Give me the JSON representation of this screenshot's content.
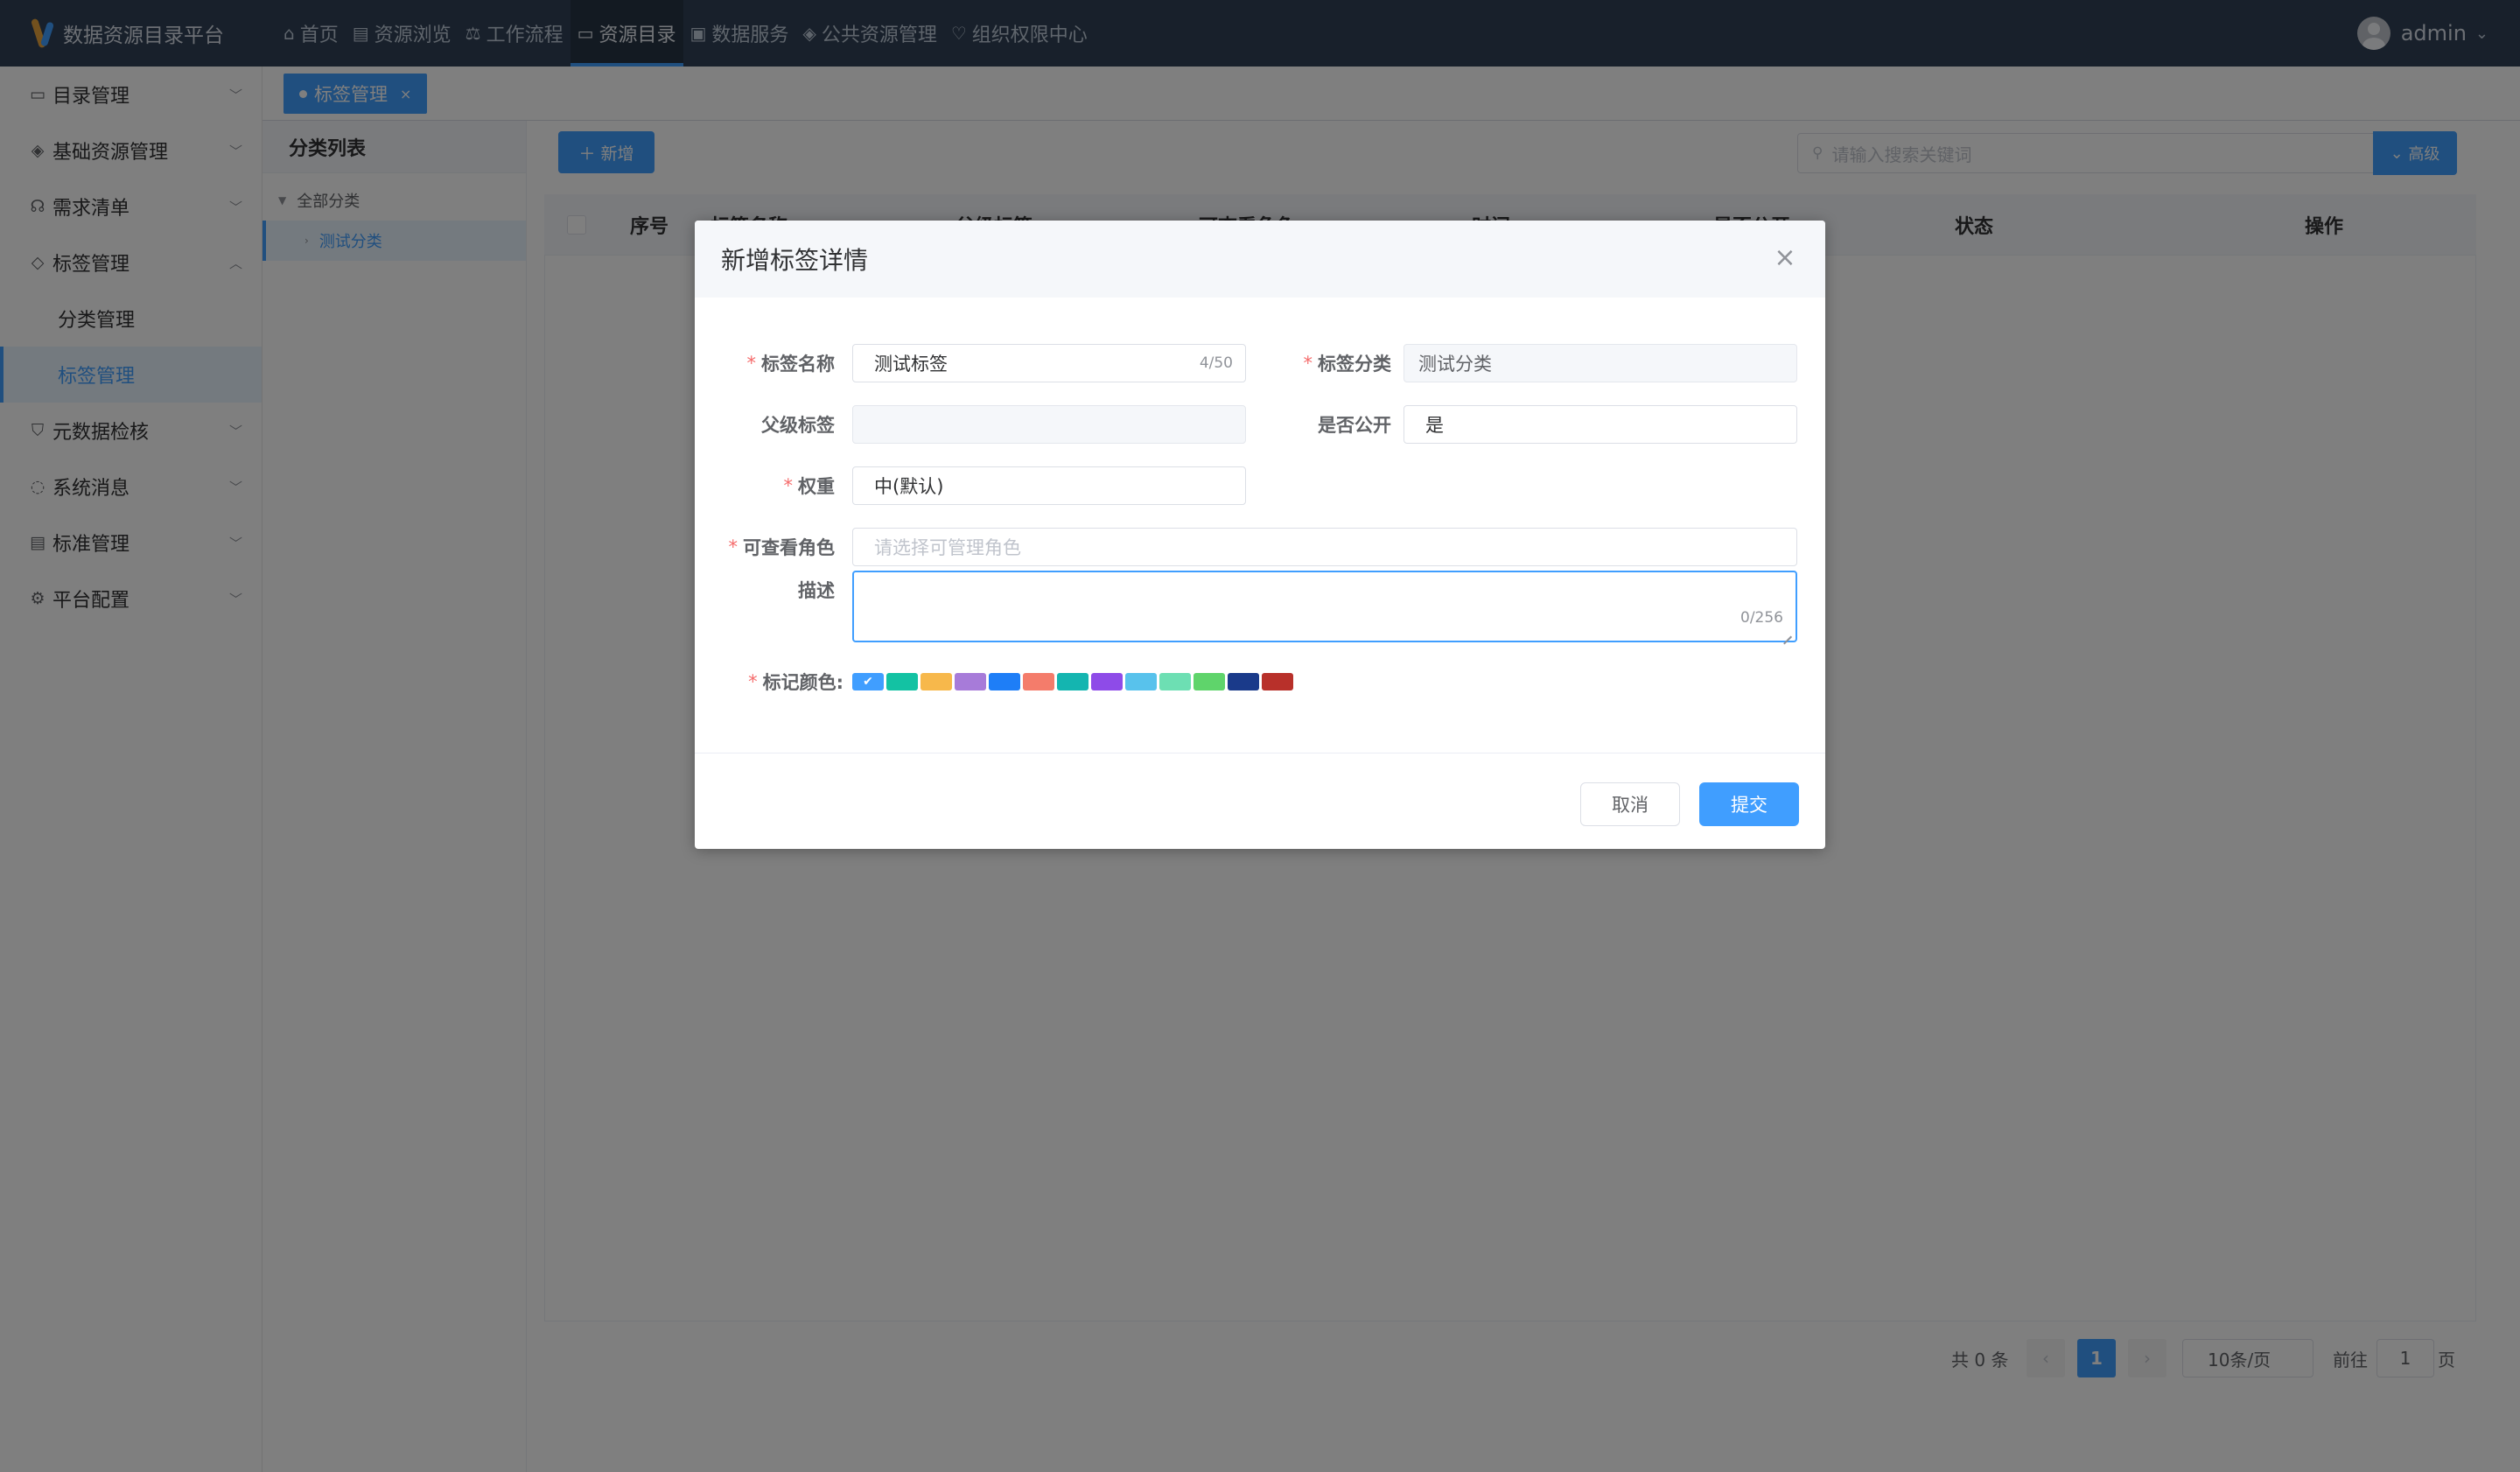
{
  "app": {
    "title": "数据资源目录平台"
  },
  "topnav": [
    {
      "label": "首页",
      "icon": "home-icon",
      "glyph": "⌂"
    },
    {
      "label": "资源浏览",
      "icon": "book-icon",
      "glyph": "▤"
    },
    {
      "label": "工作流程",
      "icon": "flow-icon",
      "glyph": "⚖"
    },
    {
      "label": "资源目录",
      "icon": "folder-icon",
      "glyph": "▭",
      "active": true
    },
    {
      "label": "数据服务",
      "icon": "box-icon",
      "glyph": "▣"
    },
    {
      "label": "公共资源管理",
      "icon": "gamepad-icon",
      "glyph": "◈"
    },
    {
      "label": "组织权限中心",
      "icon": "heart-icon",
      "glyph": "♡"
    }
  ],
  "user": {
    "name": "admin"
  },
  "sidebar": {
    "items": [
      {
        "label": "目录管理",
        "icon": "folder-icon",
        "glyph": "▭",
        "expanded": false
      },
      {
        "label": "基础资源管理",
        "icon": "layers-icon",
        "glyph": "◈",
        "expanded": false
      },
      {
        "label": "需求清单",
        "icon": "headset-icon",
        "glyph": "☊",
        "expanded": false
      },
      {
        "label": "标签管理",
        "icon": "tag-icon",
        "glyph": "◇",
        "expanded": true,
        "children": [
          {
            "label": "分类管理"
          },
          {
            "label": "标签管理",
            "active": true
          }
        ]
      },
      {
        "label": "元数据检核",
        "icon": "shield-icon",
        "glyph": "⛉",
        "expanded": false
      },
      {
        "label": "系统消息",
        "icon": "chat-icon",
        "glyph": "◌",
        "expanded": false
      },
      {
        "label": "标准管理",
        "icon": "clipboard-icon",
        "glyph": "▤",
        "expanded": false
      },
      {
        "label": "平台配置",
        "icon": "gear-icon",
        "glyph": "⚙",
        "expanded": false
      }
    ]
  },
  "tabs": [
    {
      "label": "标签管理",
      "active": true
    }
  ],
  "category_panel": {
    "title": "分类列表",
    "root": "全部分类",
    "children": [
      "测试分类"
    ]
  },
  "toolbar": {
    "add_label": "新增",
    "search_placeholder": "请输入搜索关键词",
    "advanced_label": "高级"
  },
  "table": {
    "columns": [
      "序号",
      "标签名称",
      "父级标签",
      "可查看角色",
      "时间",
      "是否公开",
      "状态",
      "操作"
    ],
    "rows": []
  },
  "pagination": {
    "total_text": "共 0 条",
    "current_page": "1",
    "page_size": "10条/页",
    "goto_label": "前往",
    "goto_value": "1",
    "page_unit": "页"
  },
  "dialog": {
    "title": "新增标签详情",
    "fields": {
      "name": {
        "label": "标签名称",
        "value": "测试标签",
        "counter": "4/50",
        "required": true
      },
      "category": {
        "label": "标签分类",
        "value": "测试分类",
        "required": true
      },
      "parent": {
        "label": "父级标签",
        "value": ""
      },
      "public": {
        "label": "是否公开",
        "value": "是"
      },
      "weight": {
        "label": "权重",
        "value": "中(默认)",
        "required": true
      },
      "roles": {
        "label": "可查看角色",
        "placeholder": "请选择可管理角色",
        "required": true
      },
      "description": {
        "label": "描述",
        "value": "",
        "counter": "0/256"
      },
      "color": {
        "label": "标记颜色:",
        "required": true
      }
    },
    "colors": [
      {
        "hex": "#409eff",
        "selected": true
      },
      {
        "hex": "#13c2a3",
        "selected": false
      },
      {
        "hex": "#f7b84b",
        "selected": false
      },
      {
        "hex": "#a77bd9",
        "selected": false
      },
      {
        "hex": "#1e7ef7",
        "selected": false
      },
      {
        "hex": "#f47c6b",
        "selected": false
      },
      {
        "hex": "#14b5b0",
        "selected": false
      },
      {
        "hex": "#8e4be8",
        "selected": false
      },
      {
        "hex": "#58c2ec",
        "selected": false
      },
      {
        "hex": "#6ddfb3",
        "selected": false
      },
      {
        "hex": "#5fd46b",
        "selected": false
      },
      {
        "hex": "#1a3a8a",
        "selected": false
      },
      {
        "hex": "#b8302a",
        "selected": false
      }
    ],
    "cancel_label": "取消",
    "submit_label": "提交"
  }
}
